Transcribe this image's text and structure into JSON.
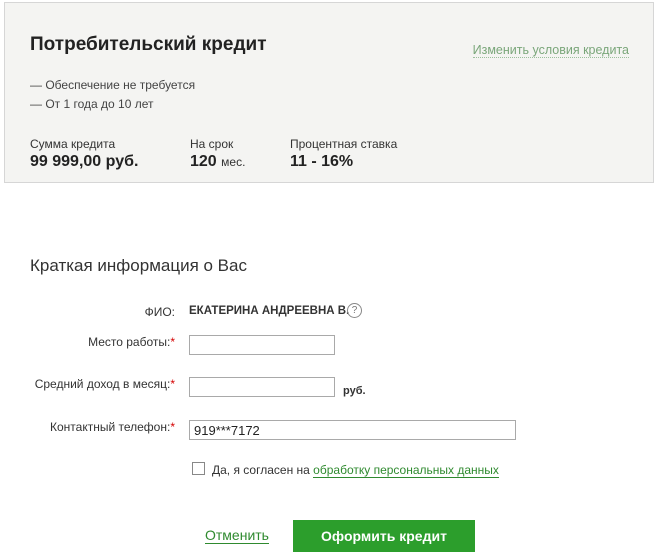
{
  "summary": {
    "title": "Потребительский кредит",
    "change_link": "Изменить условия кредита",
    "bullets": [
      "— Обеспечение не требуется",
      "— От 1 года до 10 лет"
    ],
    "amount": {
      "label": "Сумма кредита",
      "value": "99 999,00 руб."
    },
    "term": {
      "label": "На срок",
      "value": "120",
      "unit": "мес."
    },
    "rate": {
      "label": "Процентная ставка",
      "value": "11 - 16%"
    }
  },
  "form": {
    "title": "Краткая информация о Вас",
    "fio": {
      "label": "ФИО:",
      "value": "ЕКАТЕРИНА АНДРЕЕВНА В.",
      "help": "?"
    },
    "workplace": {
      "label": "Место работы:",
      "required": "*",
      "value": ""
    },
    "income": {
      "label": "Средний доход в месяц:",
      "required": "*",
      "value": "",
      "unit": "руб."
    },
    "phone": {
      "label": "Контактный телефон:",
      "required": "*",
      "value": "919***7172"
    },
    "consent": {
      "text": "Да, я согласен на ",
      "link": "обработку персональных данных",
      "checked": false
    }
  },
  "actions": {
    "cancel": "Отменить",
    "submit": "Оформить кредит"
  },
  "colors": {
    "accent": "#2c9e2c",
    "link": "#2f8a2f",
    "panel_bg": "#f4f4f2"
  }
}
